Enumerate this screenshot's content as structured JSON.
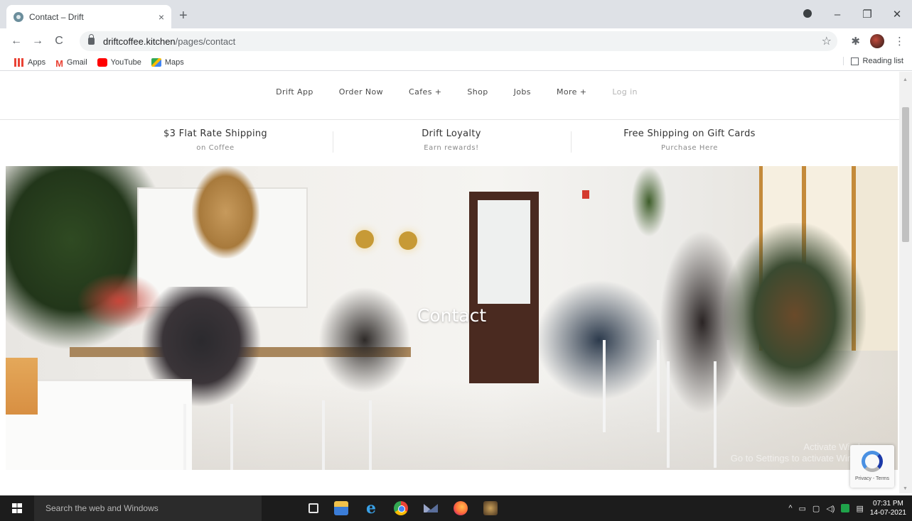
{
  "browser": {
    "tab_title": "Contact – Drift",
    "tab_close": "×",
    "new_tab": "+",
    "url_host": "driftcoffee.kitchen",
    "url_path": "/pages/contact",
    "win_minimize": "–",
    "win_restore": "❐",
    "win_close": "✕",
    "back": "←",
    "forward": "→",
    "reload": "C",
    "star": "☆",
    "extensions": "✱",
    "menu": "⋮"
  },
  "bookmarks": {
    "items": [
      {
        "label": "Apps",
        "icon": "apps-grid-icon"
      },
      {
        "label": "Gmail",
        "icon": "gmail-icon"
      },
      {
        "label": "YouTube",
        "icon": "youtube-icon"
      },
      {
        "label": "Maps",
        "icon": "maps-icon"
      }
    ],
    "reading_list": "Reading list"
  },
  "site": {
    "nav": {
      "items": [
        "Drift App",
        "Order Now",
        "Cafes +",
        "Shop",
        "Jobs",
        "More +"
      ],
      "login": "Log in"
    },
    "promos": [
      {
        "title": "$3 Flat Rate Shipping",
        "subtitle": "on Coffee"
      },
      {
        "title": "Drift Loyalty",
        "subtitle": "Earn rewards!"
      },
      {
        "title": "Free Shipping on Gift Cards",
        "subtitle": "Purchase Here"
      }
    ],
    "hero": {
      "title": "Contact",
      "watermark_line1": "Activate Windows",
      "watermark_line2": "Go to Settings to activate Windows."
    },
    "recaptcha": {
      "label": "Privacy - Terms"
    }
  },
  "taskbar": {
    "search_placeholder": "Search the web and Windows",
    "tray_arrow": "^",
    "time": "07:31 PM",
    "date": "14-07-2021"
  },
  "colors": {
    "tab_strip": "#dee1e6",
    "taskbar": "#1c1c1c",
    "nav_text": "#4a4a4a"
  }
}
